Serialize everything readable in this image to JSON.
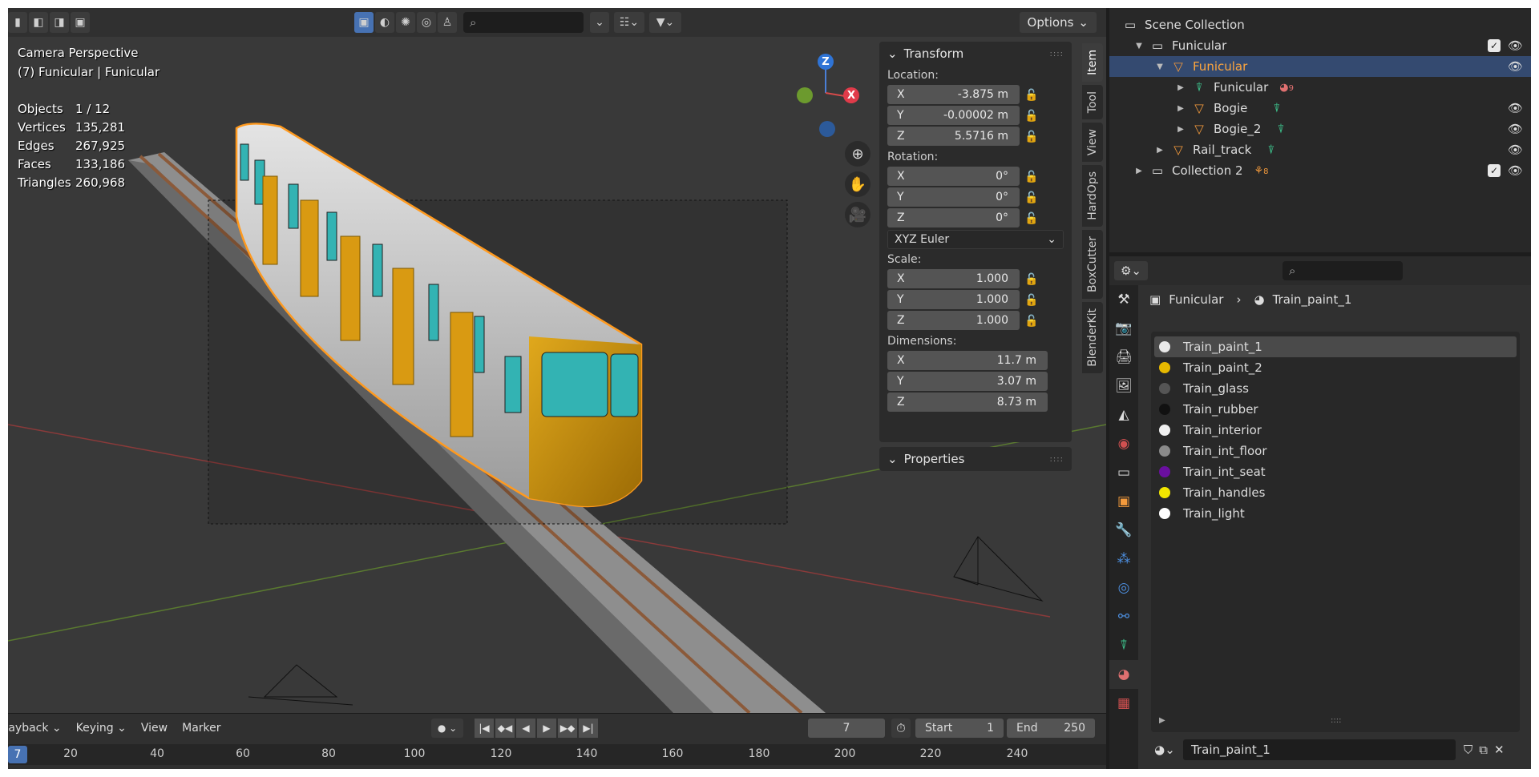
{
  "viewport": {
    "camera_label": "Camera Perspective",
    "object_label": "(7) Funicular | Funicular",
    "stats": [
      {
        "k": "Objects",
        "v": "1 / 12"
      },
      {
        "k": "Vertices",
        "v": "135,281"
      },
      {
        "k": "Edges",
        "v": "267,925"
      },
      {
        "k": "Faces",
        "v": "133,186"
      },
      {
        "k": "Triangles",
        "v": "260,968"
      }
    ],
    "options_label": "Options",
    "gizmo": {
      "z": "Z",
      "x": "X"
    }
  },
  "npanel": {
    "transform_title": "Transform",
    "location_label": "Location:",
    "location": [
      {
        "axis": "X",
        "value": "-3.875 m"
      },
      {
        "axis": "Y",
        "value": "-0.00002 m"
      },
      {
        "axis": "Z",
        "value": "5.5716 m"
      }
    ],
    "rotation_label": "Rotation:",
    "rotation": [
      {
        "axis": "X",
        "value": "0°"
      },
      {
        "axis": "Y",
        "value": "0°"
      },
      {
        "axis": "Z",
        "value": "0°"
      }
    ],
    "rotation_mode": "XYZ Euler",
    "scale_label": "Scale:",
    "scale": [
      {
        "axis": "X",
        "value": "1.000"
      },
      {
        "axis": "Y",
        "value": "1.000"
      },
      {
        "axis": "Z",
        "value": "1.000"
      }
    ],
    "dimensions_label": "Dimensions:",
    "dimensions": [
      {
        "axis": "X",
        "value": "11.7 m"
      },
      {
        "axis": "Y",
        "value": "3.07 m"
      },
      {
        "axis": "Z",
        "value": "8.73 m"
      }
    ],
    "properties_title": "Properties",
    "side_tabs": [
      "Item",
      "Tool",
      "View",
      "HardOps",
      "BoxCutter",
      "BlenderKit"
    ]
  },
  "timeline": {
    "menu": [
      "Playback",
      "Keying",
      "View",
      "Marker"
    ],
    "current_frame": "7",
    "start_label": "Start",
    "start": "1",
    "end_label": "End",
    "end": "250",
    "ruler_marks": [
      "20",
      "40",
      "60",
      "80",
      "100",
      "120",
      "140",
      "160",
      "180",
      "200",
      "220",
      "240"
    ],
    "ruler_current": "7"
  },
  "outliner": {
    "rows": [
      {
        "label": "Scene Collection"
      },
      {
        "label": "Funicular"
      },
      {
        "label": "Funicular"
      },
      {
        "label": "Funicular",
        "badge": "9"
      },
      {
        "label": "Bogie"
      },
      {
        "label": "Bogie_2"
      },
      {
        "label": "Rail_track"
      },
      {
        "label": "Collection 2",
        "badge": "8"
      }
    ]
  },
  "properties": {
    "breadcrumb_object": "Funicular",
    "breadcrumb_material": "Train_paint_1",
    "materials": [
      {
        "name": "Train_paint_1",
        "color": "#e8e8e8"
      },
      {
        "name": "Train_paint_2",
        "color": "#e6b800"
      },
      {
        "name": "Train_glass",
        "color": "#555555"
      },
      {
        "name": "Train_rubber",
        "color": "#111111"
      },
      {
        "name": "Train_interior",
        "color": "#f0f0f0"
      },
      {
        "name": "Train_int_floor",
        "color": "#8a8a8a"
      },
      {
        "name": "Train_int_seat",
        "color": "#6a0fa0"
      },
      {
        "name": "Train_handles",
        "color": "#f2e600"
      },
      {
        "name": "Train_light",
        "color": "#ffffff"
      }
    ],
    "active_material": "Train_paint_1"
  },
  "colors": {
    "accent": "#4772b3",
    "selection_outline": "#ff9a1f",
    "train_yellow": "#d99a12",
    "window_teal": "#33b3b3"
  }
}
